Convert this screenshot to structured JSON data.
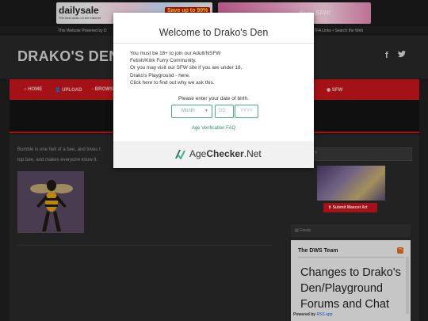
{
  "ads": {
    "daily_logo": "dailysale",
    "daily_tag": "The best deals on the internet",
    "daily_save": "Save up to 90%",
    "right_text": "...dom, SPH!"
  },
  "links": {
    "left": "This Website Powered by D",
    "right": "TFA Links • Search the Web"
  },
  "header": {
    "title": "DRAKO'S DEN",
    "facebook": "f",
    "twitter": "🐦"
  },
  "nav": {
    "items": [
      "HOME",
      "UPLOAD",
      "BROWS",
      "SFW"
    ],
    "accent": "#c8161d"
  },
  "post": {
    "line1": "Bumble is one hell of a bee, and loves t",
    "line2": "top bee, and makes everyone know it."
  },
  "sidebar": {
    "search_placeholder": "ch",
    "mascot_button": "Submit Mascot Art",
    "feeds_label": "Feeds",
    "team_title": "The DWS Team",
    "headline": "Changes to Drako's Den/Playground Forums and Chat",
    "powered_prefix": "Powered by",
    "powered_link": "RSS.app"
  },
  "modal": {
    "title": "Welcome to Drako's Den",
    "lines": [
      "You must be 18+ to join our Adult/NSFW",
      "Fetish/Kink Furry Community.",
      "Or you may visit our SFW site if you are under 18,",
      "Drako's Playground - here.",
      "Click here to find out why we ask this."
    ],
    "dob_label": "Please enter your date of birth.",
    "month_placeholder": "Month",
    "day_placeholder": "DD",
    "year_placeholder": "YYYY",
    "faq_link": "Age Verification FAQ",
    "brand_regular": "Age",
    "brand_bold": "Checker",
    "brand_suffix": ".Net",
    "accent": "#49a991"
  }
}
